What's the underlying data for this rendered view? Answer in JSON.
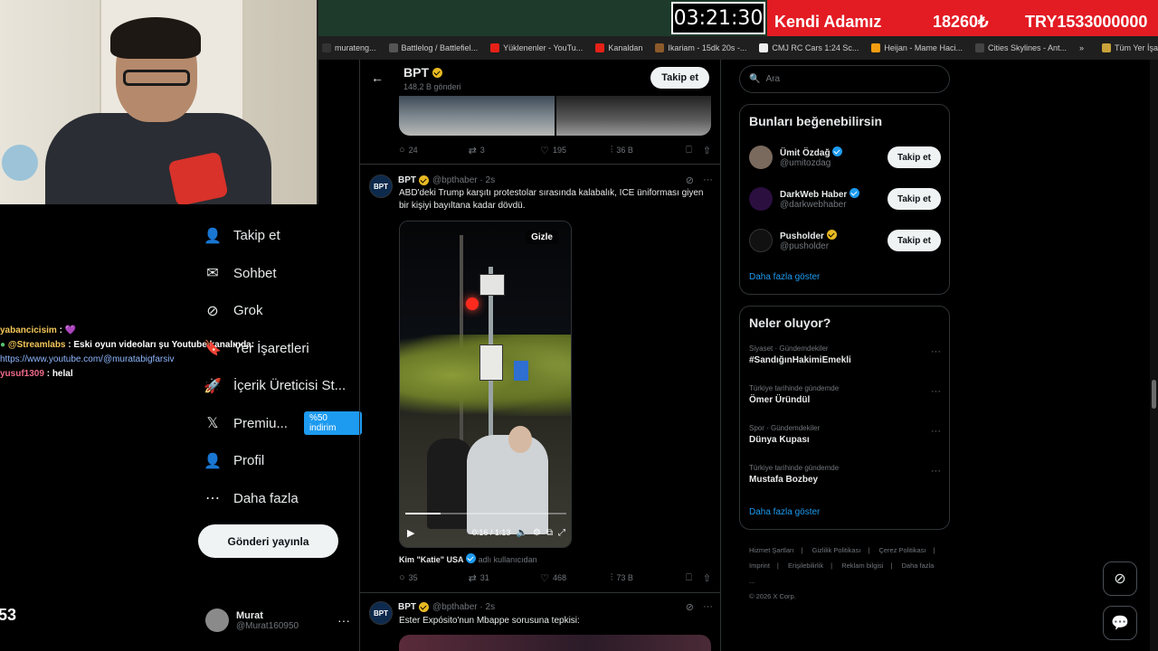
{
  "overlay": {
    "timer": "03:21:30",
    "banner_name": "Kendi Adamız",
    "banner_price": "18260₺",
    "banner_total": "TRY1533000000",
    "chat": [
      {
        "user": "yabancicisim",
        "sep": " : ",
        "text": "💜"
      },
      {
        "user": "@Streamlabs",
        "sep": " : ",
        "text": "Eski oyun videoları şu Youtube kanalında:"
      },
      {
        "user": "",
        "sep": "",
        "text": "https://www.youtube.com/@muratabigfarsiv"
      },
      {
        "user": "yusuf1309",
        "sep": " : ",
        "text": "helal"
      }
    ],
    "viewer_count": "53"
  },
  "bookmarks": {
    "items": [
      {
        "label": "murateng...",
        "color": "#333"
      },
      {
        "label": "Battlelog / Battlefiel...",
        "color": "#555"
      },
      {
        "label": "Yüklenenler - YouTu...",
        "color": "#e62117"
      },
      {
        "label": "Kanaldan",
        "color": "#e62117"
      },
      {
        "label": "Ikariam - 15dk 20s -...",
        "color": "#8b5a2b"
      },
      {
        "label": "CMJ RC Cars 1:24 Sc...",
        "color": "#eee"
      },
      {
        "label": "Heijan - Mame Haci...",
        "color": "#f39c12"
      },
      {
        "label": "Cities Skylines - Ant...",
        "color": "#444"
      }
    ],
    "overflow": "»",
    "all_bookmarks": "Tüm Yer İşaretleri"
  },
  "nav": {
    "items": [
      {
        "label": "Takip et",
        "icon": "person-add-icon",
        "glyph": "👤"
      },
      {
        "label": "Sohbet",
        "icon": "envelope-icon",
        "glyph": "✉"
      },
      {
        "label": "Grok",
        "icon": "grok-icon",
        "glyph": "⊘"
      },
      {
        "label": "Yer İşaretleri",
        "icon": "bookmark-icon",
        "glyph": "🔖"
      },
      {
        "label": "İçerik Üreticisi St...",
        "icon": "rocket-icon",
        "glyph": "🚀"
      },
      {
        "label": "Premiu...",
        "icon": "x-logo-icon",
        "glyph": "𝕏"
      },
      {
        "label": "Profil",
        "icon": "person-icon",
        "glyph": "👤"
      },
      {
        "label": "Daha fazla",
        "icon": "more-circle-icon",
        "glyph": "⋯"
      }
    ],
    "premium_badge": "%50 indirim",
    "post_button": "Gönderi yayınla",
    "account_name": "Murat",
    "account_handle": "@Murat160950",
    "account_more": "···"
  },
  "timeline": {
    "back": "←",
    "title": "BPT",
    "subtitle": "148,2 B gönderi",
    "follow": "Takip et",
    "prev_actions": {
      "replies": "24",
      "reposts": "3",
      "likes": "195",
      "views": "36 B"
    },
    "tweet1": {
      "avatar": "BPT",
      "name": "BPT",
      "handle": "@bpthaber · 2s",
      "text": "ABD'deki Trump karşıtı protestolar sırasında kalabalık, ICE üniforması giyen bir kişiyi bayıltana kadar dövdü.",
      "hide": "Gizle",
      "time": "0:16 / 1:13",
      "progress": 0.22,
      "via_name": "Kim \"Katie\" USA",
      "via_suffix": "adlı kullanıcıdan",
      "actions": {
        "replies": "35",
        "reposts": "31",
        "likes": "468",
        "views": "73 B"
      }
    },
    "tweet2": {
      "avatar": "BPT",
      "name": "BPT",
      "handle": "@bpthaber · 2s",
      "text": "Ester Expósito'nun Mbappe sorusuna tepkisi:"
    }
  },
  "sidebar": {
    "search_placeholder": "Ara",
    "suggest_title": "Bunları beğenebilirsin",
    "suggestions": [
      {
        "name": "Ümit Özdağ",
        "handle": "@umitozdag",
        "badge": "blue",
        "color": "#7a6a5e",
        "follow": "Takip et"
      },
      {
        "name": "DarkWeb Haber",
        "handle": "@darkwebhaber",
        "badge": "blue",
        "color": "#2b0f3f",
        "follow": "Takip et"
      },
      {
        "name": "Pusholder",
        "handle": "@pusholder",
        "badge": "gold",
        "color": "#111",
        "follow": "Takip et"
      }
    ],
    "suggest_more": "Daha fazla göster",
    "trends_title": "Neler oluyor?",
    "trends": [
      {
        "category": "Siyaset · Gündemdekiler",
        "title": "#SandığınHakimiEmekli"
      },
      {
        "category": "Türkiye tarihinde gündemde",
        "title": "Ömer Üründül"
      },
      {
        "category": "Spor · Gündemdekiler",
        "title": "Dünya Kupası"
      },
      {
        "category": "Türkiye tarihinde gündemde",
        "title": "Mustafa Bozbey"
      }
    ],
    "trends_more": "Daha fazla göster",
    "footer": [
      "Hizmet Şartları",
      "|",
      "Gizlilik Politikası",
      "|",
      "Çerez Politikası",
      "|",
      "Imprint",
      "|",
      "Erişilebilirlik",
      "|",
      "Reklam bilgisi",
      "|",
      "Daha fazla ...",
      "© 2026 X Corp."
    ]
  }
}
